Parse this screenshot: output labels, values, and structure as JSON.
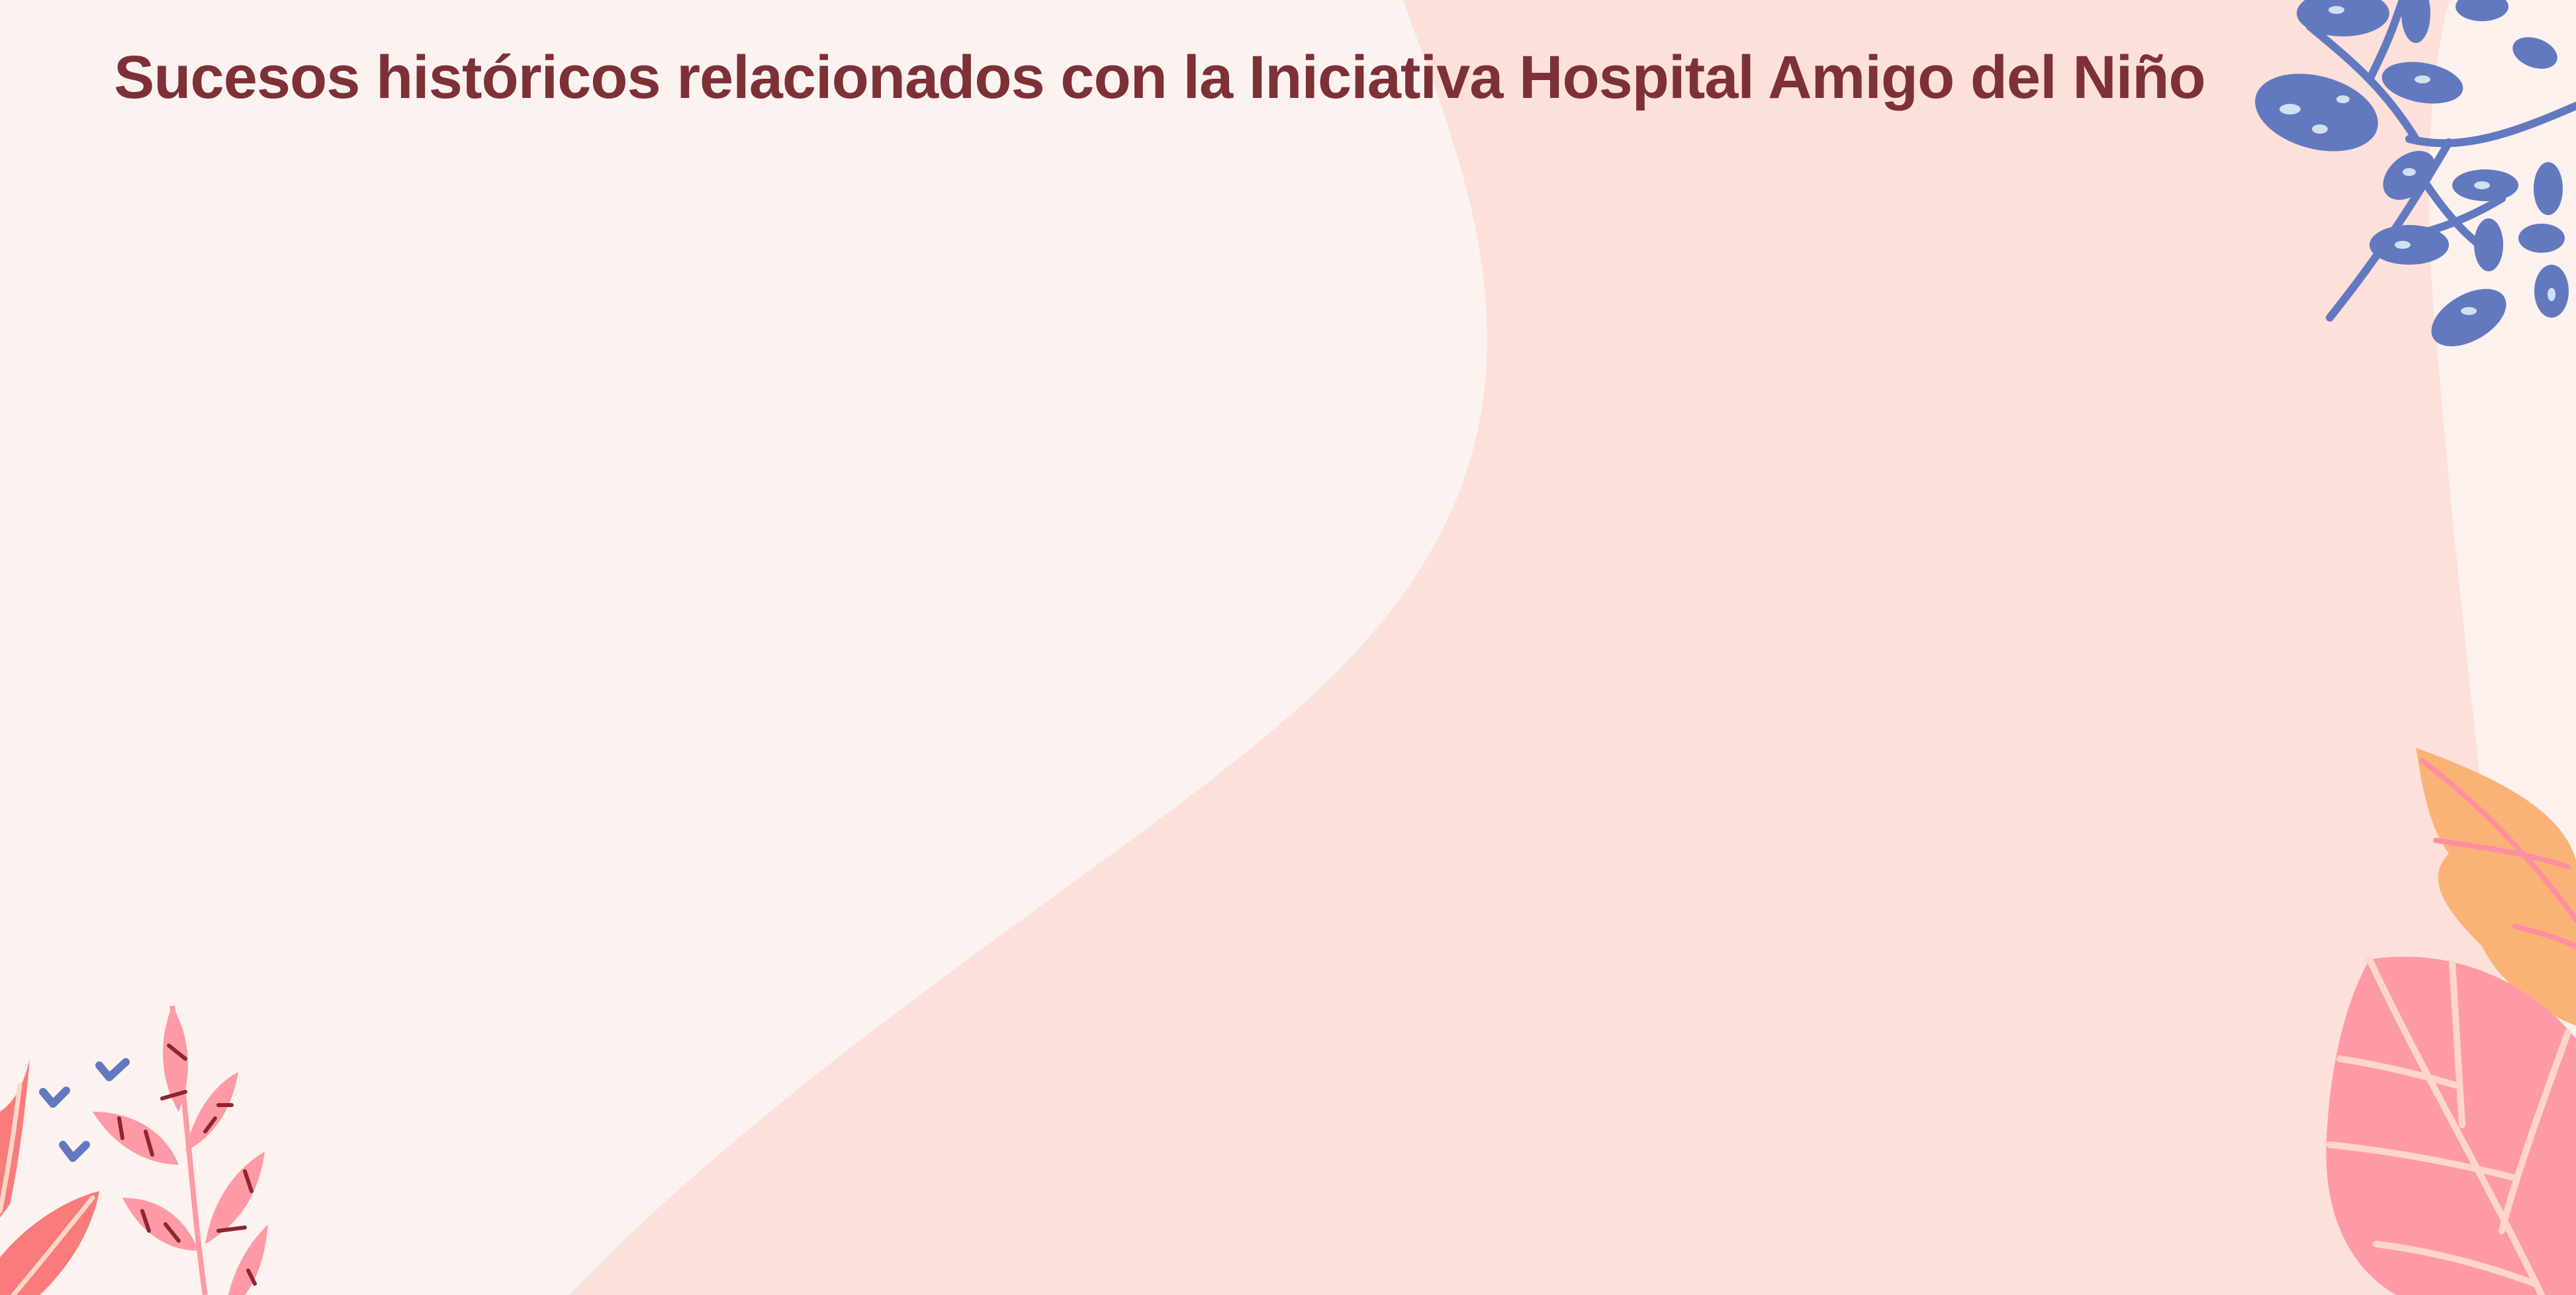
{
  "slide": {
    "title": "Sucesos históricos relacionados con la Iniciativa Hospital Amigo del Niño"
  },
  "colors": {
    "background_light": "#fcf3f0",
    "background_blob": "#fde0da",
    "title_text": "#7d3137",
    "leaf_blue": "#6279c0",
    "leaf_pink": "#fe9aa5",
    "leaf_coral": "#f97b7b",
    "leaf_orange": "#fbb276",
    "leaf_vein_dark": "#8c2732"
  },
  "decorations": [
    "blue-branch-icon",
    "orange-leaf-icon",
    "pink-leaf-icon",
    "pink-fern-icon",
    "coral-leaf-icon",
    "heart-icon"
  ]
}
